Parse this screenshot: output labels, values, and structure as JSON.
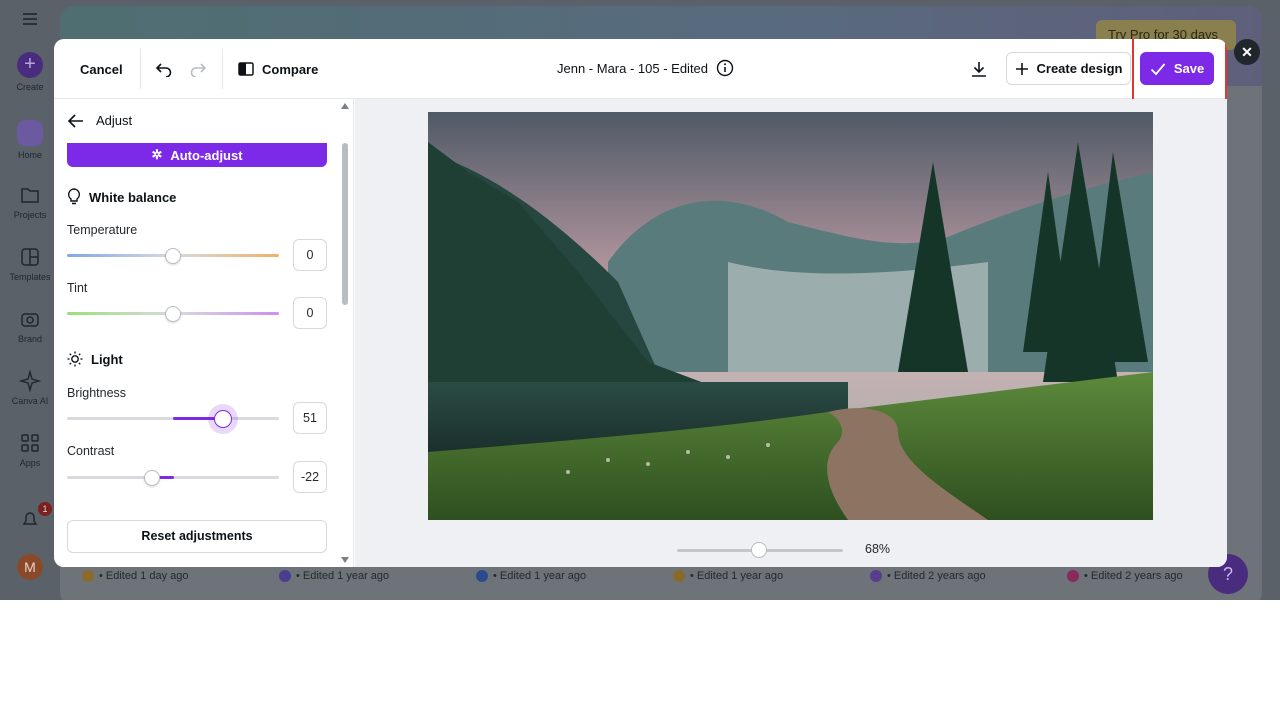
{
  "background": {
    "nav": [
      {
        "label": "Create",
        "icon": "plus-icon"
      },
      {
        "label": "Home",
        "icon": "home-icon"
      },
      {
        "label": "Projects",
        "icon": "folder-icon"
      },
      {
        "label": "Templates",
        "icon": "templates-icon"
      },
      {
        "label": "Brand",
        "icon": "brand-icon"
      },
      {
        "label": "Canva AI",
        "icon": "sparkle-icon"
      },
      {
        "label": "Apps",
        "icon": "apps-icon"
      }
    ],
    "notifications_count": "1",
    "avatar_initial": "M",
    "try_pro": "Try Pro for 30 days",
    "edited": [
      "• Edited 1 day ago",
      "• Edited 1 year ago",
      "• Edited 1 year ago",
      "• Edited 1 year ago",
      "• Edited 2 years ago",
      "• Edited 2 years ago"
    ],
    "help": "?"
  },
  "toolbar": {
    "cancel": "Cancel",
    "compare": "Compare",
    "title": "Jenn - Mara - 105 - Edited",
    "create_design": "Create design",
    "save": "Save"
  },
  "panel": {
    "heading": "Adjust",
    "auto_adjust": "Auto-adjust",
    "white_balance": "White balance",
    "light": "Light",
    "sliders": {
      "temperature": {
        "label": "Temperature",
        "value": "0"
      },
      "tint": {
        "label": "Tint",
        "value": "0"
      },
      "brightness": {
        "label": "Brightness",
        "value": "51"
      },
      "contrast": {
        "label": "Contrast",
        "value": "-22"
      }
    },
    "reset": "Reset adjustments"
  },
  "canvas": {
    "zoom": "68%"
  },
  "colors": {
    "accent": "#7d2ae8",
    "highlight": "#e2362f"
  }
}
